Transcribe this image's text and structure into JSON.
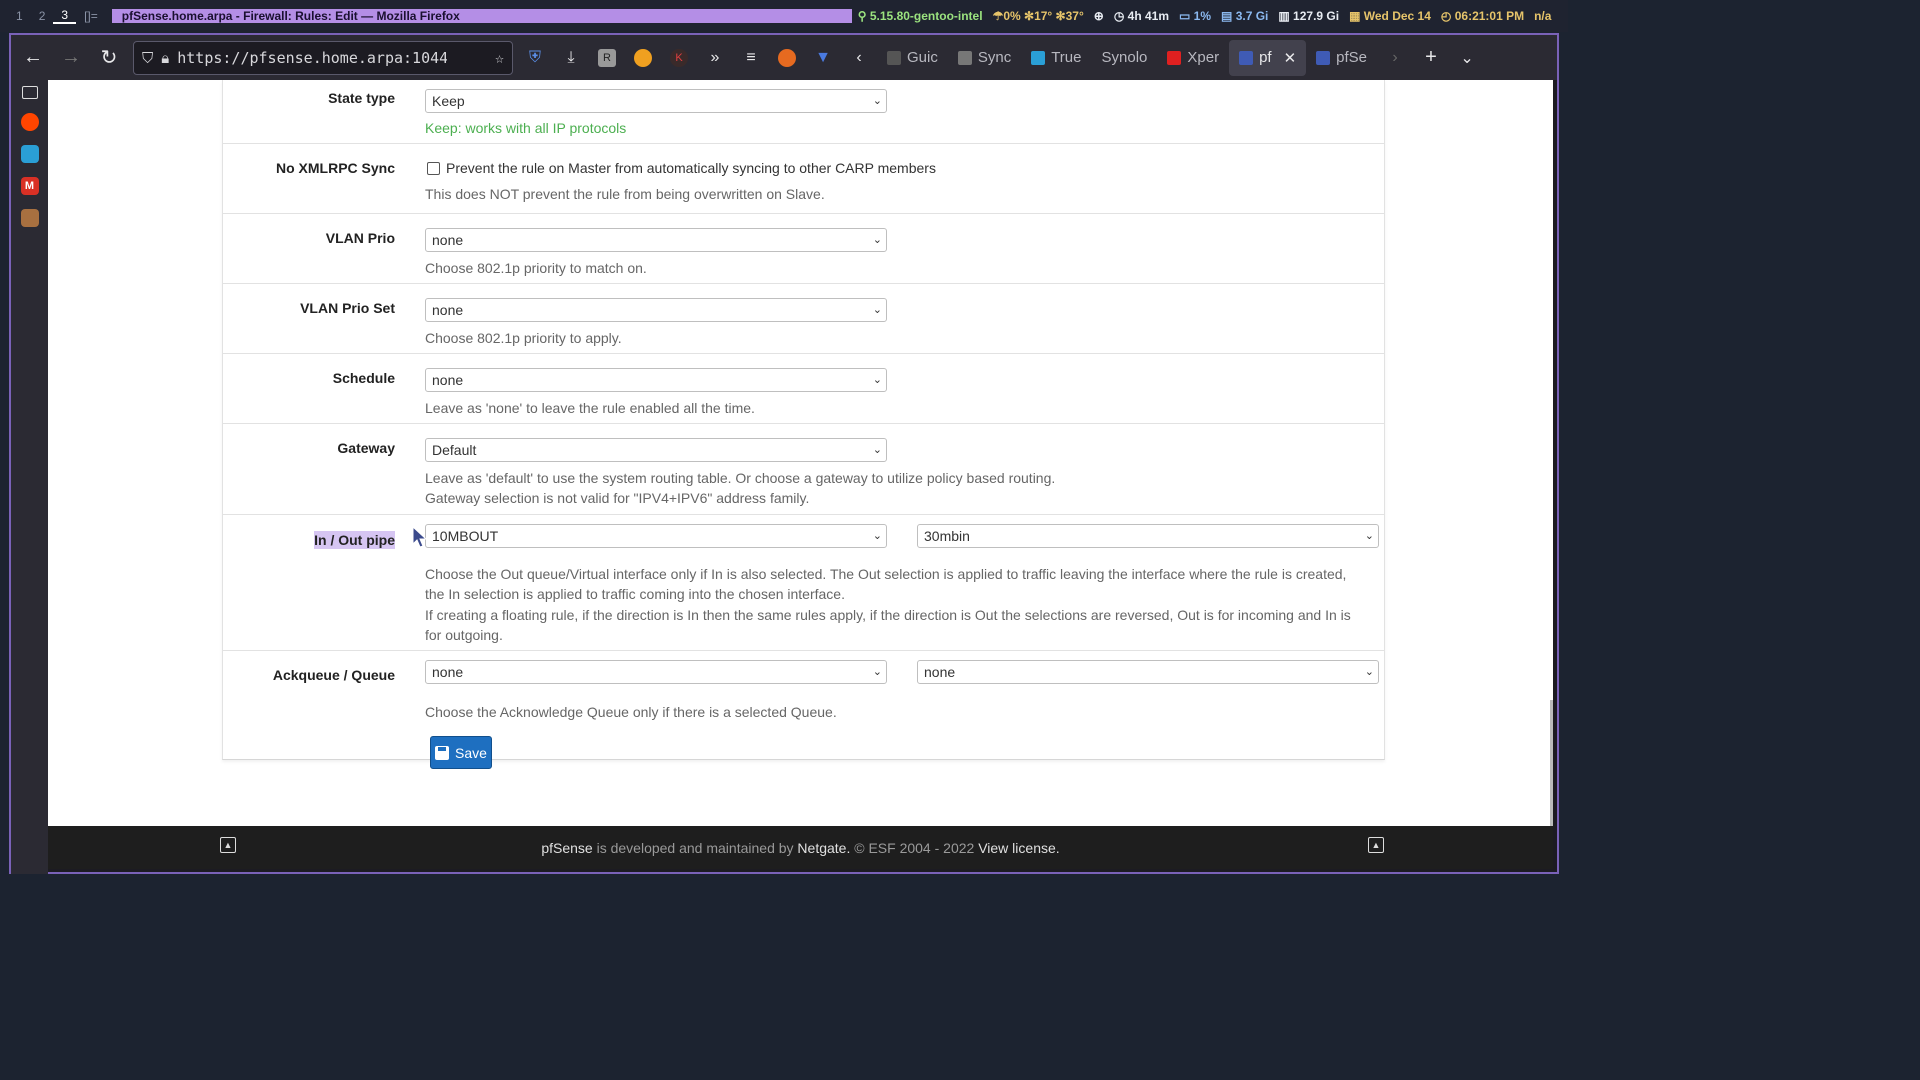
{
  "system_bar": {
    "workspaces": [
      "1",
      "2",
      "3",
      "[]="
    ],
    "window_title": "pfSense.home.arpa - Firewall: Rules: Edit — Mozilla Firefox",
    "kernel": "5.15.80-gentoo-intel",
    "cpu": "0%",
    "temp1": "17°",
    "temp2": "37°",
    "uptime": "4h 41m",
    "load": "1%",
    "mem": "3.7 Gi",
    "disk": "127.9 Gi",
    "date": "Wed Dec 14",
    "time": "06:21:01 PM",
    "extra": "n/a"
  },
  "browser": {
    "url": "https://pfsense.home.arpa:1044",
    "tabs": [
      {
        "label": "Guic",
        "color": "#555"
      },
      {
        "label": "Sync",
        "color": "#777"
      },
      {
        "label": "True",
        "color": "#2a9fd6"
      },
      {
        "label": "Synolo",
        "color": "#444"
      },
      {
        "label": "Xper",
        "color": "#e02020"
      },
      {
        "label": "pf",
        "color": "#3f5bb5",
        "active": true
      },
      {
        "label": "pfSe",
        "color": "#3f5bb5"
      }
    ]
  },
  "form": {
    "state_type": {
      "label": "State type",
      "value": "Keep",
      "help": "Keep: works with all IP protocols"
    },
    "no_xmlrpc": {
      "label": "No XMLRPC Sync",
      "checkbox_label": "Prevent the rule on Master from automatically syncing to other CARP members",
      "help": "This does NOT prevent the rule from being overwritten on Slave."
    },
    "vlan_prio": {
      "label": "VLAN Prio",
      "value": "none",
      "help": "Choose 802.1p priority to match on."
    },
    "vlan_prio_set": {
      "label": "VLAN Prio Set",
      "value": "none",
      "help": "Choose 802.1p priority to apply."
    },
    "schedule": {
      "label": "Schedule",
      "value": "none",
      "help": "Leave as 'none' to leave the rule enabled all the time."
    },
    "gateway": {
      "label": "Gateway",
      "value": "Default",
      "help1": "Leave as 'default' to use the system routing table. Or choose a gateway to utilize policy based routing.",
      "help2": "Gateway selection is not valid for \"IPV4+IPV6\" address family."
    },
    "pipe": {
      "label": "In / Out pipe",
      "in_value": "10MBOUT",
      "out_value": "30mbin",
      "help1": "Choose the Out queue/Virtual interface only if In is also selected. The Out selection is applied to traffic leaving the interface where the rule is created,",
      "help2": "the In selection is applied to traffic coming into the chosen interface.",
      "help3": "If creating a floating rule, if the direction is In then the same rules apply, if the direction is Out the selections are reversed, Out is for incoming and In is",
      "help4": "for outgoing."
    },
    "queue": {
      "label": "Ackqueue / Queue",
      "ack_value": "none",
      "queue_value": "none",
      "help": "Choose the Acknowledge Queue only if there is a selected Queue."
    },
    "save_label": "Save"
  },
  "footer": {
    "brand": "pfSense",
    "text1": "is developed and maintained by",
    "company": "Netgate.",
    "text2": "© ESF 2004 - 2022",
    "license": "View license."
  }
}
